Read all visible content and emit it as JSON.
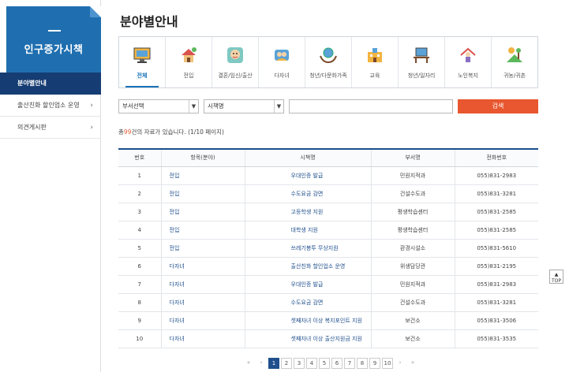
{
  "sidebar": {
    "title": "인구증가시책",
    "items": [
      {
        "label": "분야별안내",
        "active": true
      },
      {
        "label": "출산친화 할인업소 운영",
        "arrow": "›"
      },
      {
        "label": "의견게시판",
        "arrow": "›"
      }
    ]
  },
  "page_title": "분야별안내",
  "tabs": [
    {
      "label": "전체",
      "icon": "monitor-icon"
    },
    {
      "label": "전입",
      "icon": "house-icon"
    },
    {
      "label": "결혼/임신/출산",
      "icon": "baby-icon"
    },
    {
      "label": "다자녀",
      "icon": "family-icon"
    },
    {
      "label": "청년/다문화가족",
      "icon": "globe-hands-icon"
    },
    {
      "label": "교육",
      "icon": "school-icon"
    },
    {
      "label": "청년/일자리",
      "icon": "desk-icon"
    },
    {
      "label": "노인복지",
      "icon": "elder-icon"
    },
    {
      "label": "귀농/귀촌",
      "icon": "farm-icon"
    }
  ],
  "filters": {
    "dept_select": "부서선택",
    "policy_select": "시책명",
    "search_value": "",
    "search_button": "검색"
  },
  "result": {
    "prefix": "총",
    "count": "99",
    "suffix": "건의 자료가 있습니다. (1/10 페이지)"
  },
  "table": {
    "headers": [
      "번호",
      "항목(분야)",
      "시책명",
      "부서명",
      "전화번호"
    ],
    "rows": [
      [
        "1",
        "전입",
        "우대인증 발급",
        "민원지적과",
        "055)831-2983"
      ],
      [
        "2",
        "전입",
        "수도요금 감면",
        "건설수도과",
        "055)831-3281"
      ],
      [
        "3",
        "전입",
        "고등학생 지원",
        "평생학습센터",
        "055)831-2585"
      ],
      [
        "4",
        "전입",
        "대학생 지원",
        "평생학습센터",
        "055)831-2585"
      ],
      [
        "5",
        "전입",
        "쓰레기봉투 무상지원",
        "환경시설소",
        "055)831-5610"
      ],
      [
        "6",
        "다자녀",
        "출산친화 할인업소 운영",
        "위생담당관",
        "055)831-2195"
      ],
      [
        "7",
        "다자녀",
        "우대인증 발급",
        "민원지적과",
        "055)831-2983"
      ],
      [
        "8",
        "다자녀",
        "수도요금 감면",
        "건설수도과",
        "055)831-3281"
      ],
      [
        "9",
        "다자녀",
        "셋째자녀 이상 복지포인트 지원",
        "보건소",
        "055)831-3506"
      ],
      [
        "10",
        "다자녀",
        "셋째자녀 이상 출산지원금 지원",
        "보건소",
        "055)831-3535"
      ]
    ]
  },
  "pagination": {
    "first": "«",
    "prev": "‹",
    "pages": [
      "1",
      "2",
      "3",
      "4",
      "5",
      "6",
      "7",
      "8",
      "9",
      "10"
    ],
    "current": "1",
    "next": "›",
    "last": "»"
  },
  "top_button": "TOP",
  "colors": {
    "primary": "#1f6fb0",
    "navy": "#163d73",
    "accent": "#e8572f"
  }
}
